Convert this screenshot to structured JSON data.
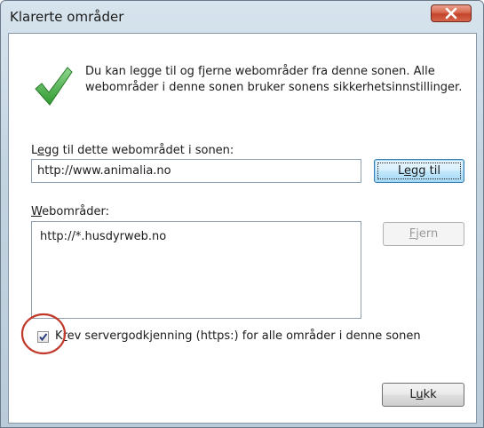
{
  "window": {
    "title": "Klarerte områder"
  },
  "icons": {
    "close": "close-icon",
    "check": "green-check-icon"
  },
  "info": {
    "text": "Du kan legge til og fjerne webområder fra denne sonen. Alle webområder i denne sonen bruker sonens sikkerhetsinnstillinger."
  },
  "add_section": {
    "label_prefix": "L",
    "label_accel": "e",
    "label_rest": "gg til dette webområdet i sonen:",
    "input_value": "http://www.animalia.no",
    "button_prefix": "L",
    "button_accel": "e",
    "button_rest": "gg til"
  },
  "sites_section": {
    "label_accel": "W",
    "label_rest": "ebområder:",
    "items": [
      "http://*.husdyrweb.no"
    ],
    "remove_accel": "F",
    "remove_rest": "jern"
  },
  "https_option": {
    "checked": true,
    "label_prefix": "K",
    "label_accel": "r",
    "label_rest": "ev servergodkjenning (https:) for alle områder i denne sonen"
  },
  "footer": {
    "close_prefix": "L",
    "close_accel": "u",
    "close_rest": "kk"
  },
  "colors": {
    "highlight_circle": "#c0392b",
    "check_green": "#3aa33a"
  }
}
